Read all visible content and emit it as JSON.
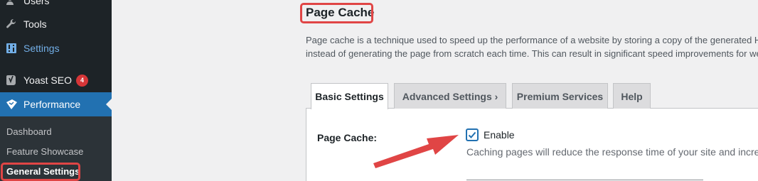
{
  "sidebar": {
    "items": [
      {
        "label": "Users",
        "icon": "users-icon"
      },
      {
        "label": "Tools",
        "icon": "wrench-icon"
      },
      {
        "label": "Settings",
        "icon": "settings-icon"
      },
      {
        "label": "Yoast SEO",
        "icon": "yoast-icon",
        "badge": "4"
      },
      {
        "label": "Performance",
        "icon": "performance-icon"
      }
    ],
    "submenu": [
      {
        "label": "Dashboard"
      },
      {
        "label": "Feature Showcase"
      },
      {
        "label": "General Settings"
      }
    ]
  },
  "main": {
    "title": "Page Cache",
    "description_line1": "Page cache is a technique used to speed up the performance of a website by storing a copy of the generated H",
    "description_line2": "instead of generating the page from scratch each time. This can result in significant speed improvements for we",
    "tabs": [
      {
        "label": "Basic Settings"
      },
      {
        "label": "Advanced Settings ›"
      },
      {
        "label": "Premium Services"
      },
      {
        "label": "Help"
      }
    ],
    "field_label": "Page Cache:",
    "checkbox_label": "Enable",
    "checkbox_checked": true,
    "help_text": "Caching pages will reduce the response time of your site and incre"
  },
  "colors": {
    "sidebar_bg": "#1d2327",
    "submenu_bg": "#2c3338",
    "active_blue": "#2271b1",
    "highlight_red": "#e04545",
    "badge_red": "#d63638"
  }
}
